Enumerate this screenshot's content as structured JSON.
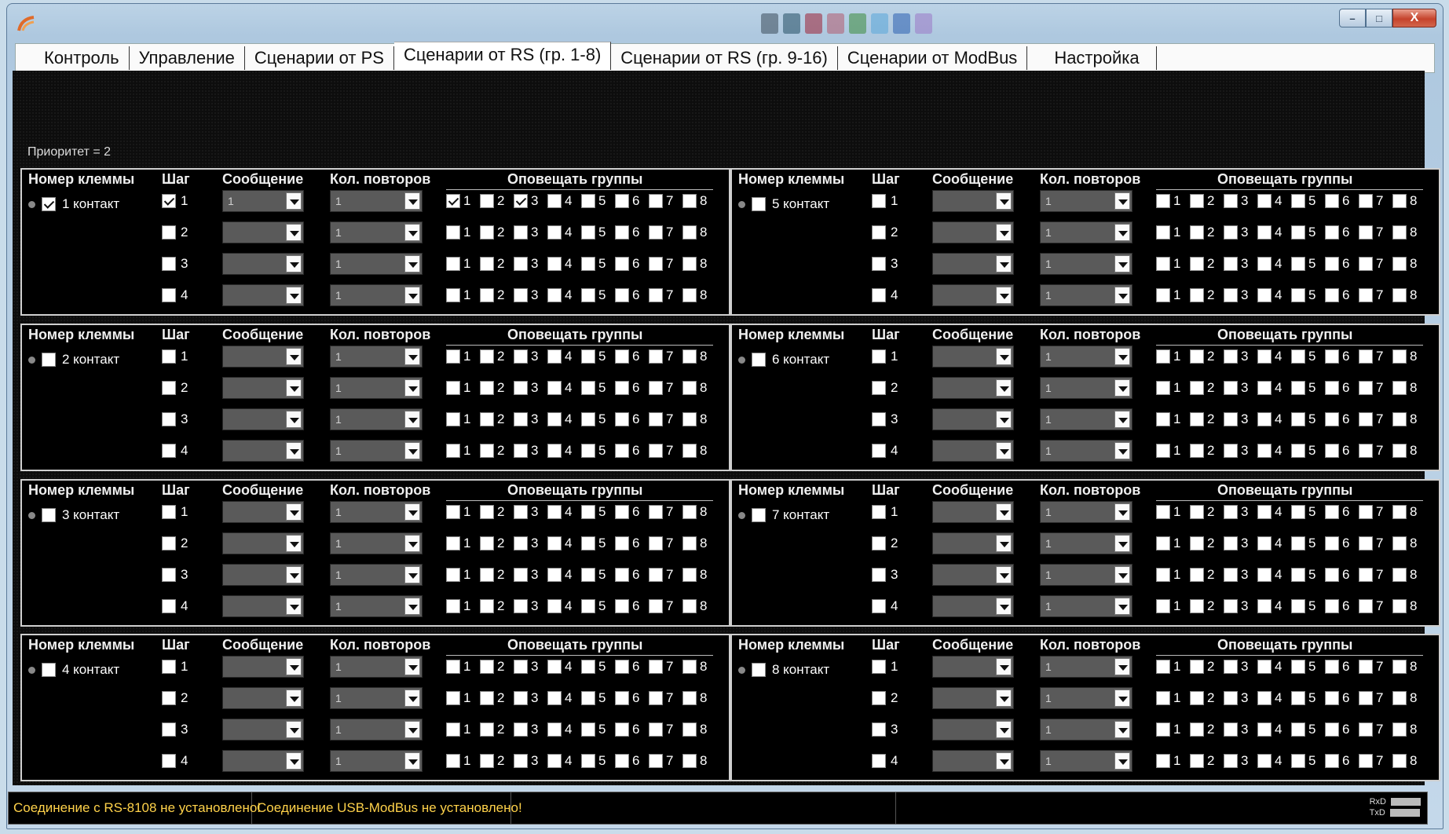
{
  "window": {
    "controls": {
      "minimize": "–",
      "maximize": "□",
      "close": "X"
    },
    "deco_colors": [
      "#3a4a5a",
      "#234d63",
      "#9c2035",
      "#b35a6d",
      "#3b8b3b",
      "#58a6d8",
      "#2a5fb0",
      "#9a78c6"
    ]
  },
  "tabs": [
    {
      "label": "Контроль",
      "active": false
    },
    {
      "label": "Управление",
      "active": false
    },
    {
      "label": "Сценарии от PS",
      "active": false
    },
    {
      "label": "Сценарии от RS (гр. 1-8)",
      "active": true
    },
    {
      "label": "Сценарии от RS (гр. 9-16)",
      "active": false
    },
    {
      "label": "Сценарии от ModBus",
      "active": false
    },
    {
      "label": "Настройка",
      "active": false
    }
  ],
  "priority_label": "Приоритет = 2",
  "headers": {
    "terminal": "Номер клеммы",
    "step": "Шаг",
    "message": "Сообщение",
    "repeats": "Кол. повторов",
    "groups": "Оповещать группы"
  },
  "panels": [
    {
      "contact": "1 контакт",
      "checked": true,
      "steps": [
        {
          "n": "1",
          "checked": true,
          "message": "1",
          "repeats": "1",
          "groups": [
            true,
            false,
            true,
            false,
            false,
            false,
            false,
            false
          ]
        },
        {
          "n": "2",
          "checked": false,
          "message": "",
          "repeats": "1",
          "groups": [
            false,
            false,
            false,
            false,
            false,
            false,
            false,
            false
          ]
        },
        {
          "n": "3",
          "checked": false,
          "message": "",
          "repeats": "1",
          "groups": [
            false,
            false,
            false,
            false,
            false,
            false,
            false,
            false
          ]
        },
        {
          "n": "4",
          "checked": false,
          "message": "",
          "repeats": "1",
          "groups": [
            false,
            false,
            false,
            false,
            false,
            false,
            false,
            false
          ]
        }
      ]
    },
    {
      "contact": "5 контакт",
      "checked": false,
      "steps": []
    },
    {
      "contact": "2 контакт",
      "checked": false,
      "steps": []
    },
    {
      "contact": "6 контакт",
      "checked": false,
      "steps": []
    },
    {
      "contact": "3 контакт",
      "checked": false,
      "steps": []
    },
    {
      "contact": "7 контакт",
      "checked": false,
      "steps": []
    },
    {
      "contact": "4 контакт",
      "checked": false,
      "steps": []
    },
    {
      "contact": "8 контакт",
      "checked": false,
      "steps": []
    }
  ],
  "default_steps": [
    {
      "n": "1",
      "checked": false,
      "message": "",
      "repeats": "1",
      "groups": [
        false,
        false,
        false,
        false,
        false,
        false,
        false,
        false
      ]
    },
    {
      "n": "2",
      "checked": false,
      "message": "",
      "repeats": "1",
      "groups": [
        false,
        false,
        false,
        false,
        false,
        false,
        false,
        false
      ]
    },
    {
      "n": "3",
      "checked": false,
      "message": "",
      "repeats": "1",
      "groups": [
        false,
        false,
        false,
        false,
        false,
        false,
        false,
        false
      ]
    },
    {
      "n": "4",
      "checked": false,
      "message": "",
      "repeats": "1",
      "groups": [
        false,
        false,
        false,
        false,
        false,
        false,
        false,
        false
      ]
    }
  ],
  "group_numbers": [
    "1",
    "2",
    "3",
    "4",
    "5",
    "6",
    "7",
    "8"
  ],
  "status": {
    "rs_connection": "Соединение с RS-8108 не установлено!",
    "usb_connection": "Соединение USB-ModBus не установлено!",
    "rxd": "RxD",
    "txd": "TxD"
  }
}
